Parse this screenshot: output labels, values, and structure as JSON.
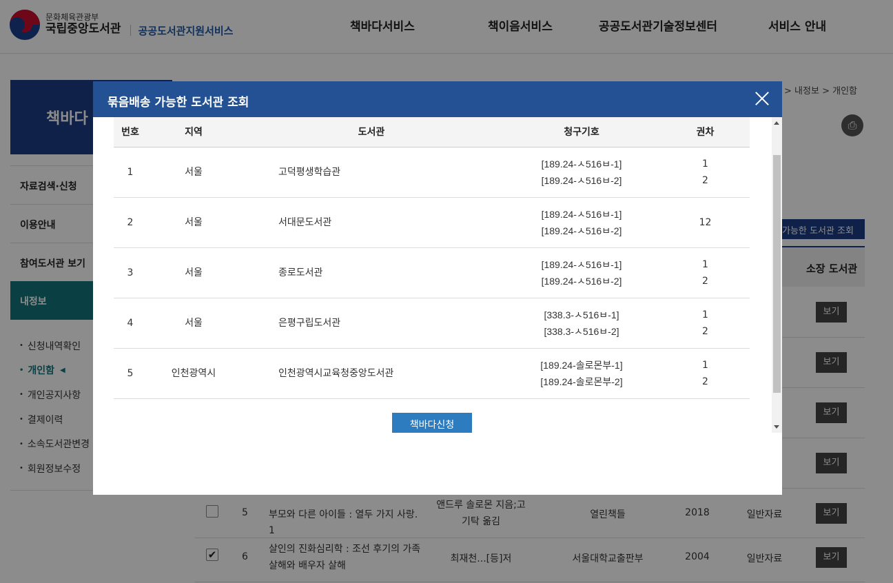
{
  "header": {
    "ministry": "문화체육관광부",
    "library_name": "국립중앙도서관",
    "service_name": "공공도서관지원서비스",
    "nav": [
      "책바다서비스",
      "책이음서비스",
      "공공도서관기술정보센터",
      "서비스 안내"
    ]
  },
  "sidebar": {
    "title": "책바다",
    "menu": [
      "자료검색·신청",
      "이용안내",
      "참여도서관 보기",
      "내정보"
    ],
    "submenu": [
      "신청내역확인",
      "개인함",
      "개인공지사항",
      "결제이력",
      "소속도서관변경",
      "회원정보수정"
    ]
  },
  "breadcrumb": [
    "내정보",
    "개인함"
  ],
  "main": {
    "lib_search_button": "가능한 도서관 조회",
    "holding_header": "소장 도서관",
    "view_label": "보기",
    "rows": [
      {
        "no": "5",
        "title": "부모와 다른 아이들 : 열두 가지 사랑. 1",
        "author": "앤드루 솔로몬 지음;고기탁 옮김",
        "publisher": "열린책들",
        "year": "2018",
        "type": "일반자료",
        "checked": false
      },
      {
        "no": "6",
        "title": "살인의 진화심리학 : 조선 후기의 가족 살해와 배우자 살해",
        "author": "최재천...[등]저",
        "publisher": "서울대학교출판부",
        "year": "2004",
        "type": "일반자료",
        "checked": true
      }
    ]
  },
  "modal": {
    "title": "묶음배송 가능한 도서관 조회",
    "columns": [
      "번호",
      "지역",
      "도서관",
      "청구기호",
      "권차"
    ],
    "rows": [
      {
        "no": "1",
        "region": "서울",
        "library": "고덕평생학습관",
        "callno1": "[189.24-ㅅ516ㅂ-1]",
        "callno2": "[189.24-ㅅ516ㅂ-2]",
        "vol1": "1",
        "vol2": "2"
      },
      {
        "no": "2",
        "region": "서울",
        "library": "서대문도서관",
        "callno1": "[189.24-ㅅ516ㅂ-1]",
        "callno2": "[189.24-ㅅ516ㅂ-2]",
        "vol1": "12",
        "vol2": ""
      },
      {
        "no": "3",
        "region": "서울",
        "library": "종로도서관",
        "callno1": "[189.24-ㅅ516ㅂ-1]",
        "callno2": "[189.24-ㅅ516ㅂ-2]",
        "vol1": "1",
        "vol2": "2"
      },
      {
        "no": "4",
        "region": "서울",
        "library": "은평구립도서관",
        "callno1": "[338.3-ㅅ516ㅂ-1]",
        "callno2": "[338.3-ㅅ516ㅂ-2]",
        "vol1": "1",
        "vol2": "2"
      },
      {
        "no": "5",
        "region": "인천광역시",
        "library": "인천광역시교육청중앙도서관",
        "callno1": "[189.24-솔로몬부-1]",
        "callno2": "[189.24-솔로몬부-2]",
        "vol1": "1",
        "vol2": "2"
      }
    ],
    "apply_button": "책바다신청"
  }
}
